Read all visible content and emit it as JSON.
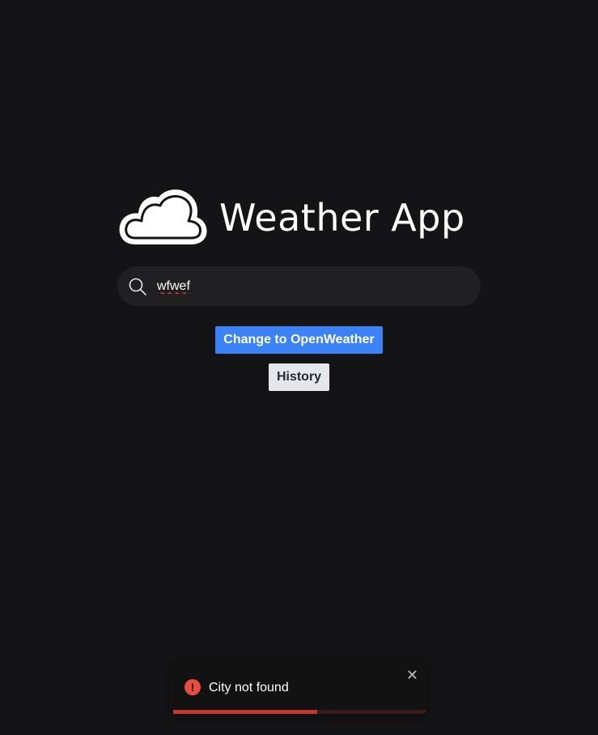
{
  "app": {
    "title": "Weather App",
    "logo_icon": "cloud-icon"
  },
  "search": {
    "value": "wfwef",
    "icon": "search-icon"
  },
  "buttons": {
    "provider_label": "Change to OpenWeather",
    "history_label": "History"
  },
  "toast": {
    "message": "City not found",
    "icon": "error-icon",
    "icon_glyph": "!",
    "close_glyph": "✕",
    "progress": 0.57,
    "accent_color": "#e74c3c"
  },
  "colors": {
    "background": "#141416",
    "primary": "#3b82f6",
    "secondary": "#e5e7eb"
  }
}
